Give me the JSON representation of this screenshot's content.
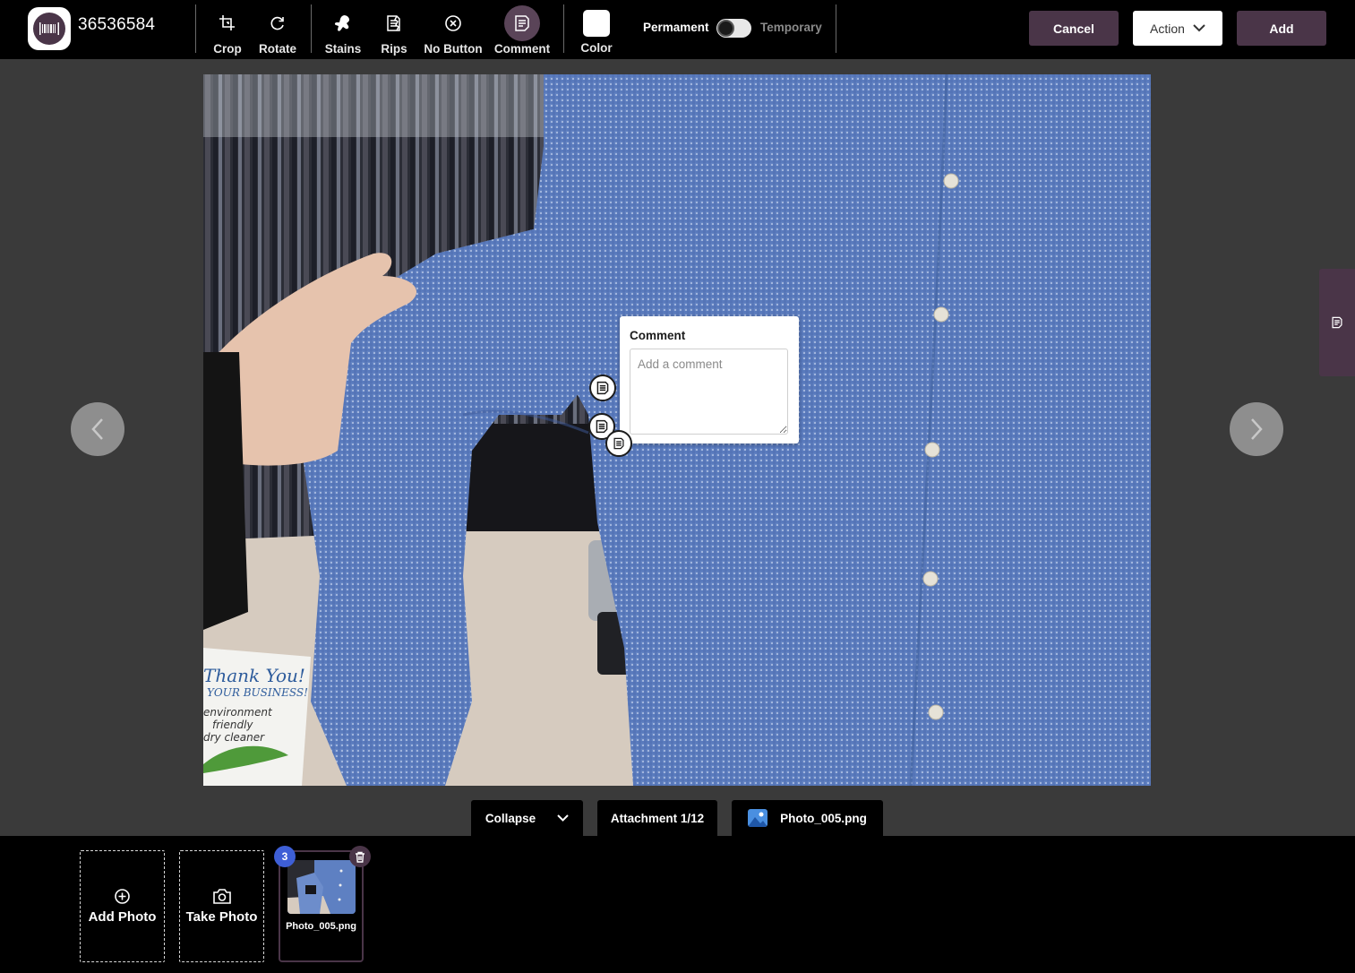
{
  "header": {
    "ticket_number": "36536584",
    "tools": [
      {
        "label": "Crop",
        "icon": "crop-icon"
      },
      {
        "label": "Rotate",
        "icon": "rotate-icon"
      },
      {
        "label": "Stains",
        "icon": "stain-icon"
      },
      {
        "label": "Rips",
        "icon": "rip-icon"
      },
      {
        "label": "No Button",
        "icon": "no-button-icon"
      },
      {
        "label": "Comment",
        "icon": "comment-icon",
        "active": true
      },
      {
        "label": "Color",
        "icon": "color-swatch",
        "value": "#ffffff"
      }
    ],
    "permanence": {
      "left_label": "Permament",
      "right_label": "Temporary",
      "selected": "Permament"
    },
    "cancel_label": "Cancel",
    "action_label": "Action",
    "add_label": "Add"
  },
  "editor": {
    "comment_popup": {
      "title": "Comment",
      "placeholder": "Add a comment",
      "value": ""
    },
    "markers": [
      "comment-marker",
      "comment-marker",
      "comment-marker"
    ],
    "photo_text": {
      "sign_line1": "Thank You!",
      "sign_line2": "YOUR BUSINESS!",
      "sign_line3": "environment",
      "sign_line4": "friendly",
      "sign_line5": "dry cleaner"
    }
  },
  "attachment_bar": {
    "collapse_label": "Collapse",
    "attachment_label": "Attachment 1/12",
    "file_name": "Photo_005.png"
  },
  "tray": {
    "add_photo_label": "Add Photo",
    "take_photo_label": "Take Photo",
    "thumbnails": [
      {
        "name": "Photo_005.png",
        "badge": "3"
      }
    ]
  },
  "colors": {
    "accent": "#4a3548",
    "badge": "#3e5fd6",
    "stage_bg": "#3a3a3a"
  }
}
